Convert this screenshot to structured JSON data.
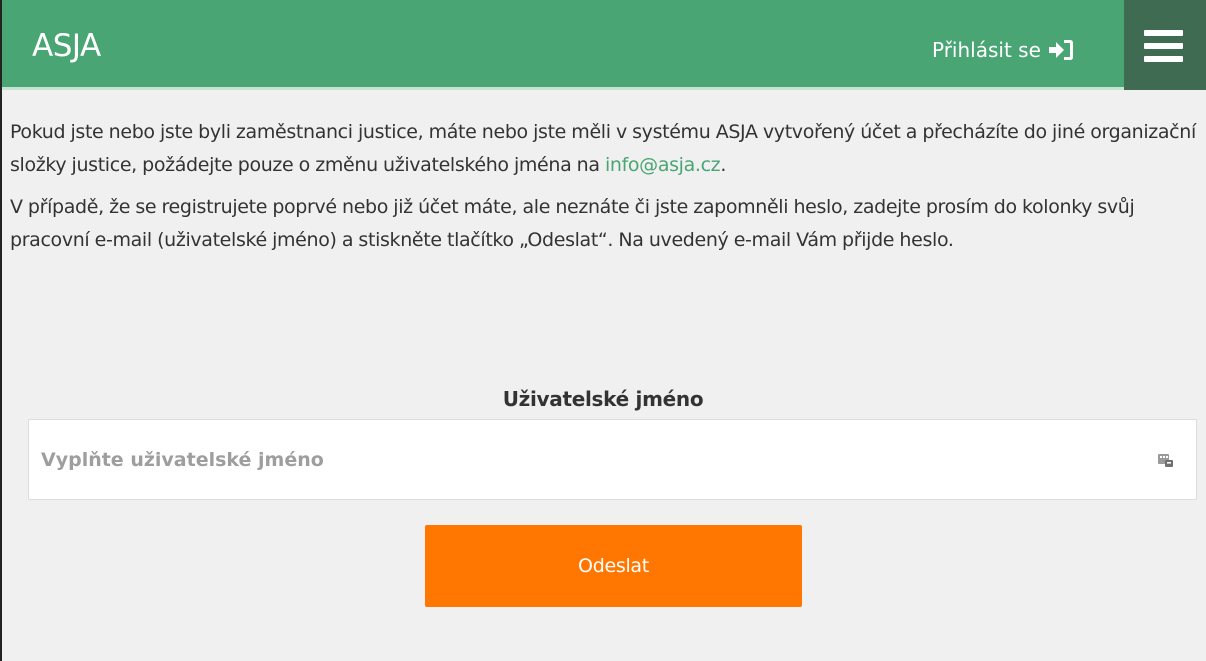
{
  "header": {
    "brand": "ASJA",
    "login_label": "Přihlásit se",
    "login_icon": "sign-in-icon",
    "menu_icon": "hamburger-menu-icon"
  },
  "intro": {
    "paragraph1_text": "Pokud jste nebo jste byli zaměstnanci justice, máte nebo jste měli v systému ASJA vytvořený účet a přecházíte do jiné organizační složky justice, požádejte pouze o změnu uživatelského jména na ",
    "paragraph1_link": "info@asja.cz",
    "paragraph1_end": ".",
    "paragraph2": "V případě, že se registrujete poprvé nebo již účet máte, ale neznáte či jste zapomněli heslo, zadejte prosím do kolonky svůj pracovní e-mail (uživatelské jméno) a stiskněte tlačítko „Odeslat“. Na uvedený e-mail Vám přijde heslo."
  },
  "form": {
    "username_label": "Uživatelské jméno",
    "username_placeholder": "Vyplňte uživatelské jméno",
    "username_value": "",
    "field_icon": "password-manager-icon",
    "submit_label": "Odeslat"
  },
  "colors": {
    "header_green": "#4aa574",
    "menu_dark_green": "#3e6b52",
    "link_green": "#4aa574",
    "button_orange": "#ff7700",
    "background": "#f0f0f0"
  }
}
